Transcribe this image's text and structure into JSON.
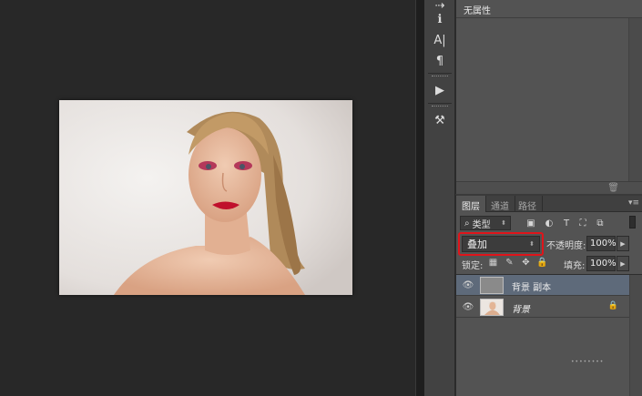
{
  "properties": {
    "title": "无属性"
  },
  "layers_panel": {
    "tabs": [
      {
        "label": "图层",
        "active": true
      },
      {
        "label": "通道",
        "active": false
      },
      {
        "label": "路径",
        "active": false
      }
    ],
    "kind_filter": "类型",
    "blend_mode": "叠加",
    "opacity_label": "不透明度:",
    "opacity_value": "100%",
    "lock_label": "锁定:",
    "fill_label": "填充:",
    "fill_value": "100%",
    "layers": [
      {
        "name": "背景 副本",
        "selected": true,
        "visible": true,
        "locked": false
      },
      {
        "name": "背景",
        "selected": false,
        "visible": true,
        "locked": true
      }
    ]
  },
  "colors": {
    "highlight": "#e0141a",
    "selected_row": "#5e6a7a",
    "panel_bg": "#535353",
    "canvas_bg": "#282828"
  }
}
